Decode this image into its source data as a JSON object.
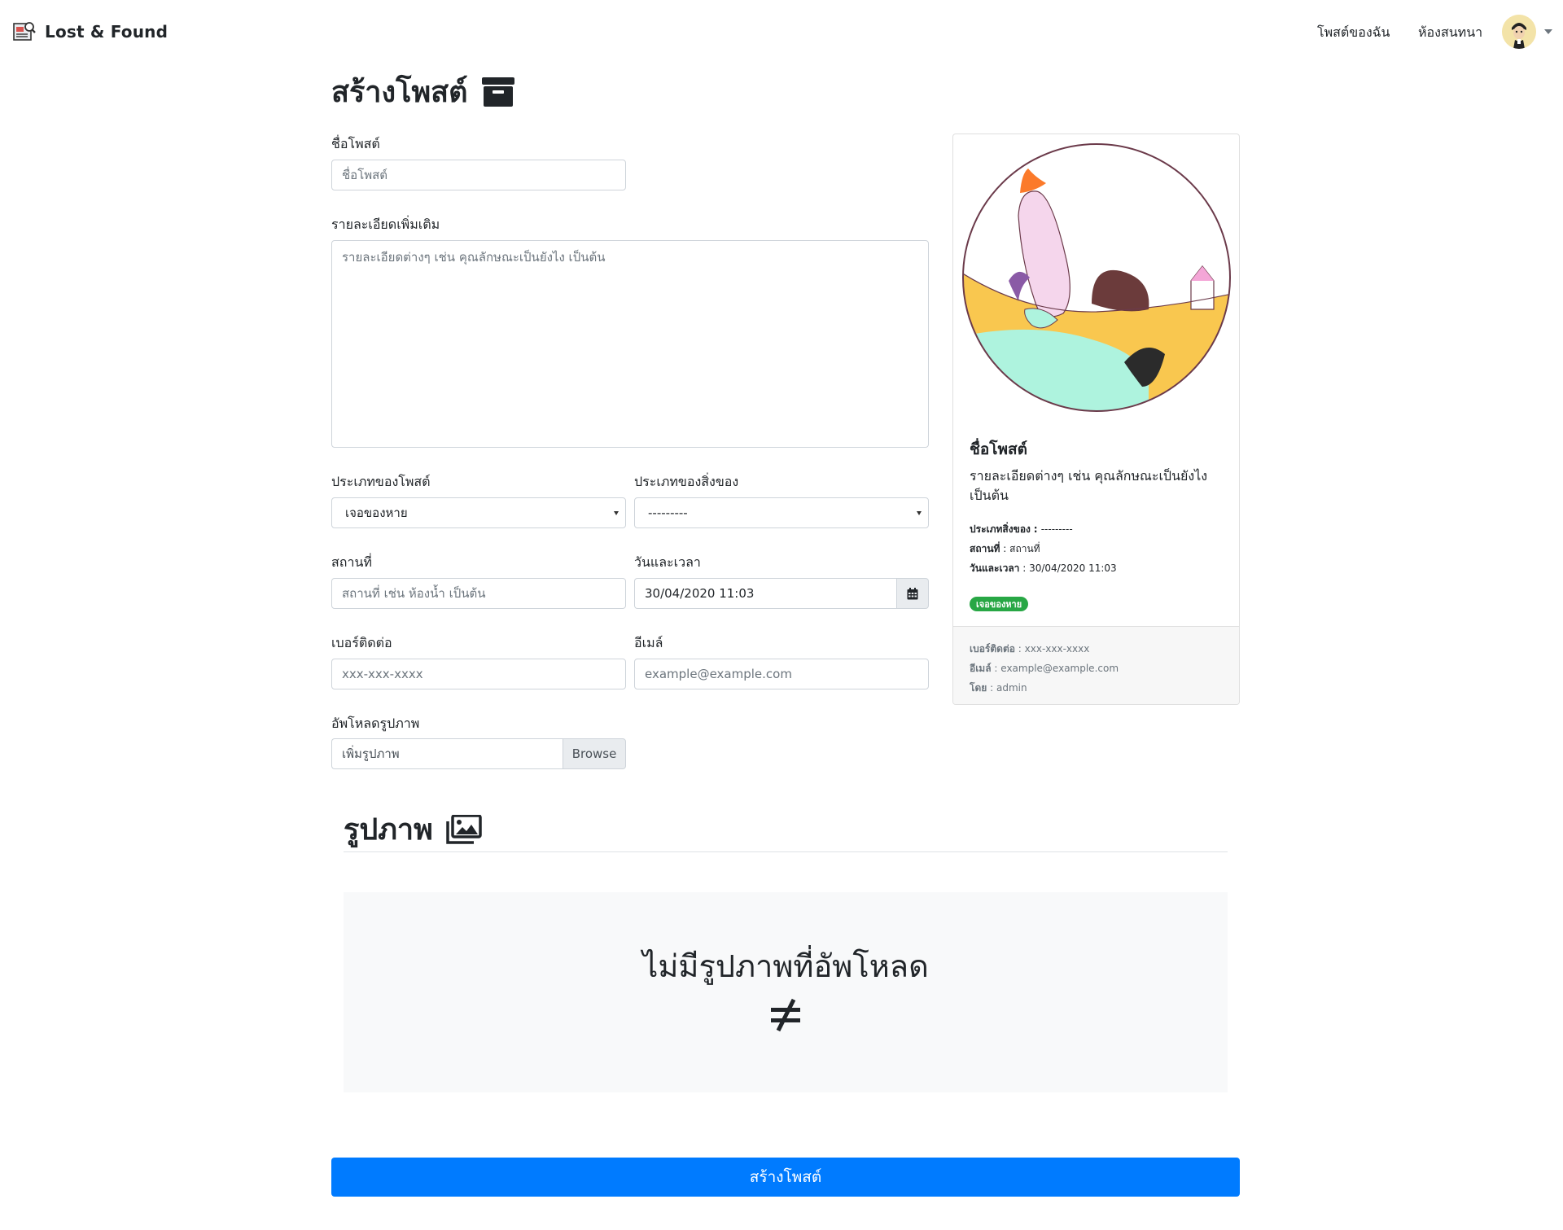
{
  "navbar": {
    "brand": "Lost & Found",
    "links": [
      "โพสต์ของฉัน",
      "ห้องสนทนา"
    ]
  },
  "page": {
    "title": "สร้างโพสต์"
  },
  "form": {
    "post_name": {
      "label": "ชื่อโพสต์",
      "placeholder": "ชื่อโพสต์"
    },
    "details": {
      "label": "รายละเอียดเพิ่มเติม",
      "placeholder": "รายละเอียดต่างๆ เช่น คุณลักษณะเป็นยังไง เป็นต้น"
    },
    "post_type": {
      "label": "ประเภทของโพสต์",
      "value": "เจอของหาย"
    },
    "item_type": {
      "label": "ประเภทของสิ่งของ",
      "value": "---------"
    },
    "location": {
      "label": "สถานที่",
      "placeholder": "สถานที่ เช่น ห้องน้ำ เป็นต้น"
    },
    "datetime": {
      "label": "วันและเวลา",
      "value": "30/04/2020 11:03"
    },
    "phone": {
      "label": "เบอร์ติดต่อ",
      "placeholder": "xxx-xxx-xxxx"
    },
    "email": {
      "label": "อีเมล์",
      "placeholder": "example@example.com"
    },
    "upload": {
      "label": "อัพโหลดรูปภาพ",
      "placeholder": "เพิ่มรูปภาพ",
      "browse": "Browse"
    }
  },
  "preview": {
    "title": "ชื่อโพสต์",
    "text": "รายละเอียดต่างๆ เช่น คุณลักษณะเป็นยังไง เป็นต้น",
    "item_type_label": "ประเภทสิ่งของ",
    "item_type_value": "---------",
    "location_label": "สถานที่",
    "location_value": "สถานที่",
    "datetime_label": "วันและเวลา",
    "datetime_value": "30/04/2020 11:03",
    "badge": "เจอของหาย",
    "badge_color": "#28a745",
    "phone_label": "เบอร์ติดต่อ",
    "phone_value": "xxx-xxx-xxxx",
    "email_label": "อีเมล์",
    "email_value": "example@example.com",
    "by_label": "โดย",
    "by_value": "admin"
  },
  "images": {
    "title": "รูปภาพ",
    "empty_text": "ไม่มีรูปภาพที่อัพโหลด"
  },
  "submit": {
    "label": "สร้างโพสต์",
    "color": "#007bff"
  },
  "icons": [
    "newspaper-search-icon",
    "archive-icon",
    "images-icon",
    "not-equal-icon",
    "calendar-icon"
  ]
}
